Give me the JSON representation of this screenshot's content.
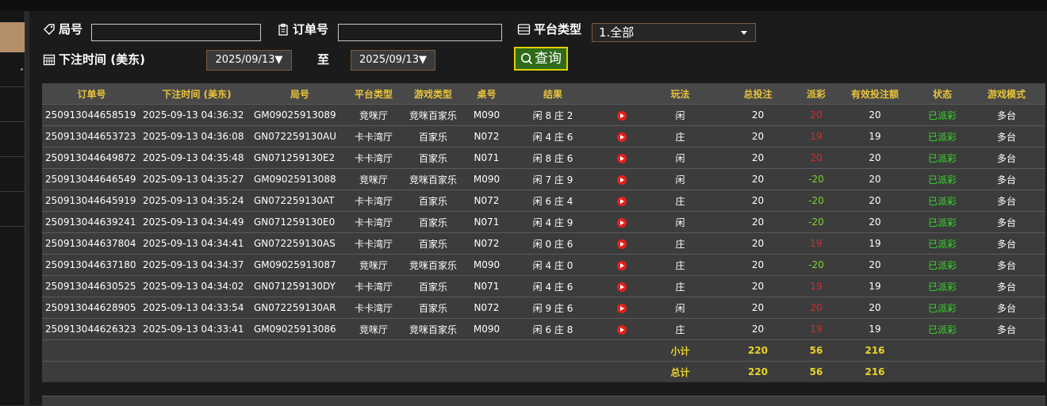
{
  "filters": {
    "round_label": "局号",
    "round_value": "",
    "order_label": "订单号",
    "order_value": "",
    "platform_label": "平台类型",
    "platform_selected": "1.全部",
    "time_label": "下注时间 (美东)",
    "date_from": "2025/09/13▼",
    "to_label": "至",
    "date_to": "2025/09/13▼",
    "query_label": "查询"
  },
  "table": {
    "headers": [
      "订单号",
      "下注时间 (美东)",
      "局号",
      "平台类型",
      "游戏类型",
      "桌号",
      "结果",
      "",
      "玩法",
      "总投注",
      "派彩",
      "有效投注额",
      "状态",
      "游戏模式"
    ],
    "rows": [
      [
        "250913044658519",
        "2025-09-13 04:36:32",
        "GM09025913089",
        "竞咪厅",
        "竞咪百家乐",
        "M090",
        "闲 8 庄 2",
        "",
        "闲",
        "20",
        "20",
        "20",
        "已派彩",
        "多台"
      ],
      [
        "250913044653723",
        "2025-09-13 04:36:08",
        "GN072259130AU",
        "卡卡湾厅",
        "百家乐",
        "N072",
        "闲 4 庄 6",
        "",
        "庄",
        "20",
        "19",
        "19",
        "已派彩",
        "多台"
      ],
      [
        "250913044649872",
        "2025-09-13 04:35:48",
        "GN071259130E2",
        "卡卡湾厅",
        "百家乐",
        "N071",
        "闲 8 庄 6",
        "",
        "闲",
        "20",
        "20",
        "20",
        "已派彩",
        "多台"
      ],
      [
        "250913044646549",
        "2025-09-13 04:35:27",
        "GM09025913088",
        "竞咪厅",
        "竞咪百家乐",
        "M090",
        "闲 7 庄 9",
        "",
        "闲",
        "20",
        "-20",
        "20",
        "已派彩",
        "多台"
      ],
      [
        "250913044645919",
        "2025-09-13 04:35:24",
        "GN072259130AT",
        "卡卡湾厅",
        "百家乐",
        "N072",
        "闲 6 庄 4",
        "",
        "庄",
        "20",
        "-20",
        "20",
        "已派彩",
        "多台"
      ],
      [
        "250913044639241",
        "2025-09-13 04:34:49",
        "GN071259130E0",
        "卡卡湾厅",
        "百家乐",
        "N071",
        "闲 4 庄 9",
        "",
        "闲",
        "20",
        "-20",
        "20",
        "已派彩",
        "多台"
      ],
      [
        "250913044637804",
        "2025-09-13 04:34:41",
        "GN072259130AS",
        "卡卡湾厅",
        "百家乐",
        "N072",
        "闲 0 庄 6",
        "",
        "庄",
        "20",
        "19",
        "19",
        "已派彩",
        "多台"
      ],
      [
        "250913044637180",
        "2025-09-13 04:34:37",
        "GM09025913087",
        "竞咪厅",
        "竞咪百家乐",
        "M090",
        "闲 4 庄 0",
        "",
        "庄",
        "20",
        "-20",
        "20",
        "已派彩",
        "多台"
      ],
      [
        "250913044630525",
        "2025-09-13 04:34:02",
        "GN071259130DY",
        "卡卡湾厅",
        "百家乐",
        "N071",
        "闲 4 庄 6",
        "",
        "庄",
        "20",
        "19",
        "19",
        "已派彩",
        "多台"
      ],
      [
        "250913044628905",
        "2025-09-13 04:33:54",
        "GN072259130AR",
        "卡卡湾厅",
        "百家乐",
        "N072",
        "闲 9 庄 6",
        "",
        "闲",
        "20",
        "20",
        "20",
        "已派彩",
        "多台"
      ],
      [
        "250913044626323",
        "2025-09-13 04:33:41",
        "GM09025913086",
        "竞咪厅",
        "竞咪百家乐",
        "M090",
        "闲 6 庄 8",
        "",
        "庄",
        "20",
        "19",
        "19",
        "已派彩",
        "多台"
      ]
    ],
    "subtotal": {
      "label": "小计",
      "bet": "220",
      "payout": "56",
      "valid": "216"
    },
    "total": {
      "label": "总计",
      "bet": "220",
      "payout": "56",
      "valid": "216"
    }
  },
  "colors": {
    "accent": "#e8c33a",
    "positive_payout": "#d62b2b",
    "negative_payout": "#7fd42b",
    "status": "#39d92b",
    "query_border": "#e3d000"
  }
}
